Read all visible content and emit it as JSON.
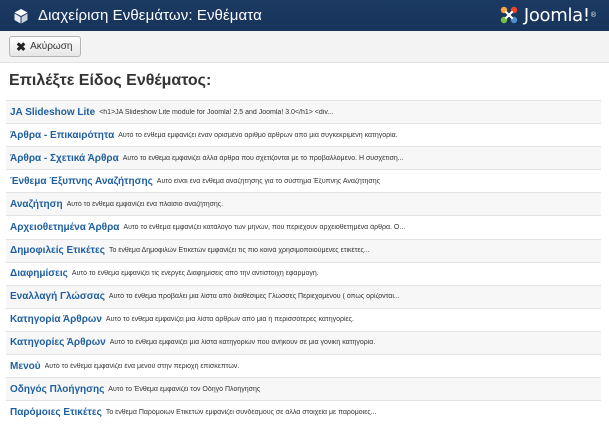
{
  "header": {
    "title": "Διαχείριση Ενθεμάτων: Ενθέματα",
    "logo_text": "Joomla!",
    "logo_reg": "®",
    "icon": "cube-icon"
  },
  "toolbar": {
    "cancel_label": "Ακύρωση",
    "cancel_icon": "close-icon"
  },
  "main": {
    "heading": "Επιλέξτε Είδος Ενθέματος:",
    "modules": [
      {
        "name": "JA Slideshow Lite",
        "desc": "<h1>JA Slideshow Lite module for Joomla! 2.5 and Joomla! 3.0</h1> <div..."
      },
      {
        "name": "Άρθρα - Επικαιρότητα",
        "desc": "Αυτό το ένθεμα εμφανίζει έναν ορισμένο αριθμό άρθρων από μια συγκεκριμένη κατηγορία."
      },
      {
        "name": "Άρθρα - Σχετικά Άρθρα",
        "desc": "Αυτό το ένθεμα εμφανίζει άλλα άρθρα που σχετίζονται με το προβαλλόμενο. Η συσχέτιση..."
      },
      {
        "name": "Ένθεμα Έξυπνης Αναζήτησης",
        "desc": "Αυτό είναι ένα ένθεμα αναζήτησης για το σύστημα Έξυπνης Αναζήτησης"
      },
      {
        "name": "Αναζήτηση",
        "desc": "Αυτό το ένθεμα εμφανίζει ένα πλαίσιο αναζήτησης."
      },
      {
        "name": "Αρχειοθετημένα Άρθρα",
        "desc": "Αυτό το ένθεμα εμφανίζει κατάλογο των μηνών, που περιέχουν αρχειοθετημένα άρθρα. Ο..."
      },
      {
        "name": "Δημοφιλείς Ετικέτες",
        "desc": "Το ένθεμα Δημοφιλών Ετικετών εμφανίζει τις πιο κοινά χρησιμοποιούμενες ετικέτες..."
      },
      {
        "name": "Διαφημίσεις",
        "desc": "Αυτό το ένθεμα εμφανίζει τις ενεργές Διαφημίσεις από την αντίστοιχη εφαρμογή."
      },
      {
        "name": "Εναλλαγή Γλώσσας",
        "desc": "Αυτό το ένθεμα προβάλει μια λίστα από διαθέσιμες Γλώσσες Περιεχομένου ( όπως ορίζονται..."
      },
      {
        "name": "Κατηγορία Άρθρων",
        "desc": "Αυτό το ένθεμα εμφανίζει μια λίστα άρθρων από μία ή περισσότερες κατηγορίες."
      },
      {
        "name": "Κατηγορίες Άρθρων",
        "desc": "Αυτό το ένθεμα εμφανίζει μια λίστα κατηγοριών που ανήκουν σε μια γονική κατηγορία."
      },
      {
        "name": "Μενού",
        "desc": "Αυτό το ένθεμα εμφανίζει ένα μενού στην περιοχή επισκεπτών."
      },
      {
        "name": "Οδηγός Πλοήγησης",
        "desc": "Αυτό το Ένθεμα εμφανίζει τον Οδηγό Πλοήγησης"
      },
      {
        "name": "Παρόμοιες Ετικέτες",
        "desc": "Το ένθεμα Παρόμοιων Ετικετών εμφανίζει συνδέσμους σε άλλα στοιχεία με παρόμοιες..."
      }
    ]
  }
}
